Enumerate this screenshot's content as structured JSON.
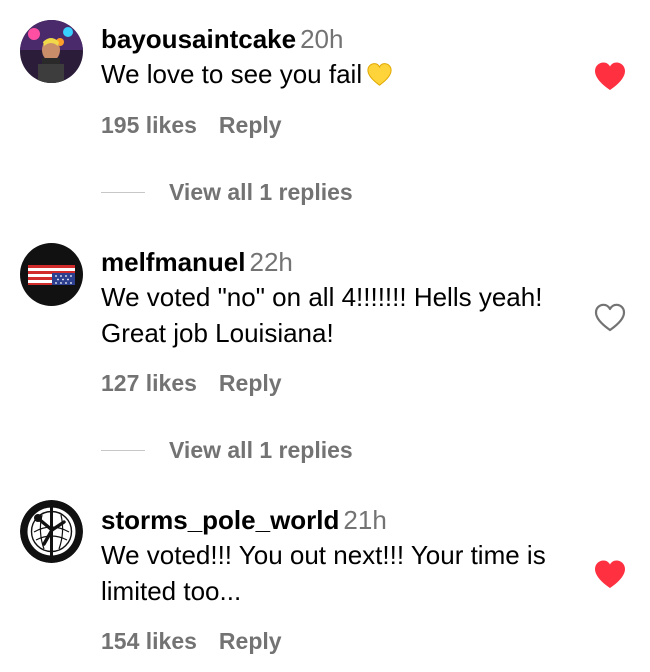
{
  "comments": [
    {
      "username": "bayousaintcake",
      "time": "20h",
      "text": "We love to see you fail",
      "emoji": "yellow-heart",
      "likes": "195 likes",
      "reply": "Reply",
      "liked": true,
      "view_replies": "View all 1 replies"
    },
    {
      "username": "melfmanuel",
      "time": "22h",
      "text": "We voted \"no\" on all 4!!!!!!! Hells yeah! Great job Louisiana!",
      "likes": "127 likes",
      "reply": "Reply",
      "liked": false,
      "view_replies": "View all 1 replies"
    },
    {
      "username": "storms_pole_world",
      "time": "21h",
      "text": "We voted!!! You out next!!! Your time is limited too...",
      "likes": "154 likes",
      "reply": "Reply",
      "liked": true
    }
  ],
  "colors": {
    "like_red": "#ff3040",
    "muted_text": "#737373",
    "divider": "#c7c7c7"
  }
}
